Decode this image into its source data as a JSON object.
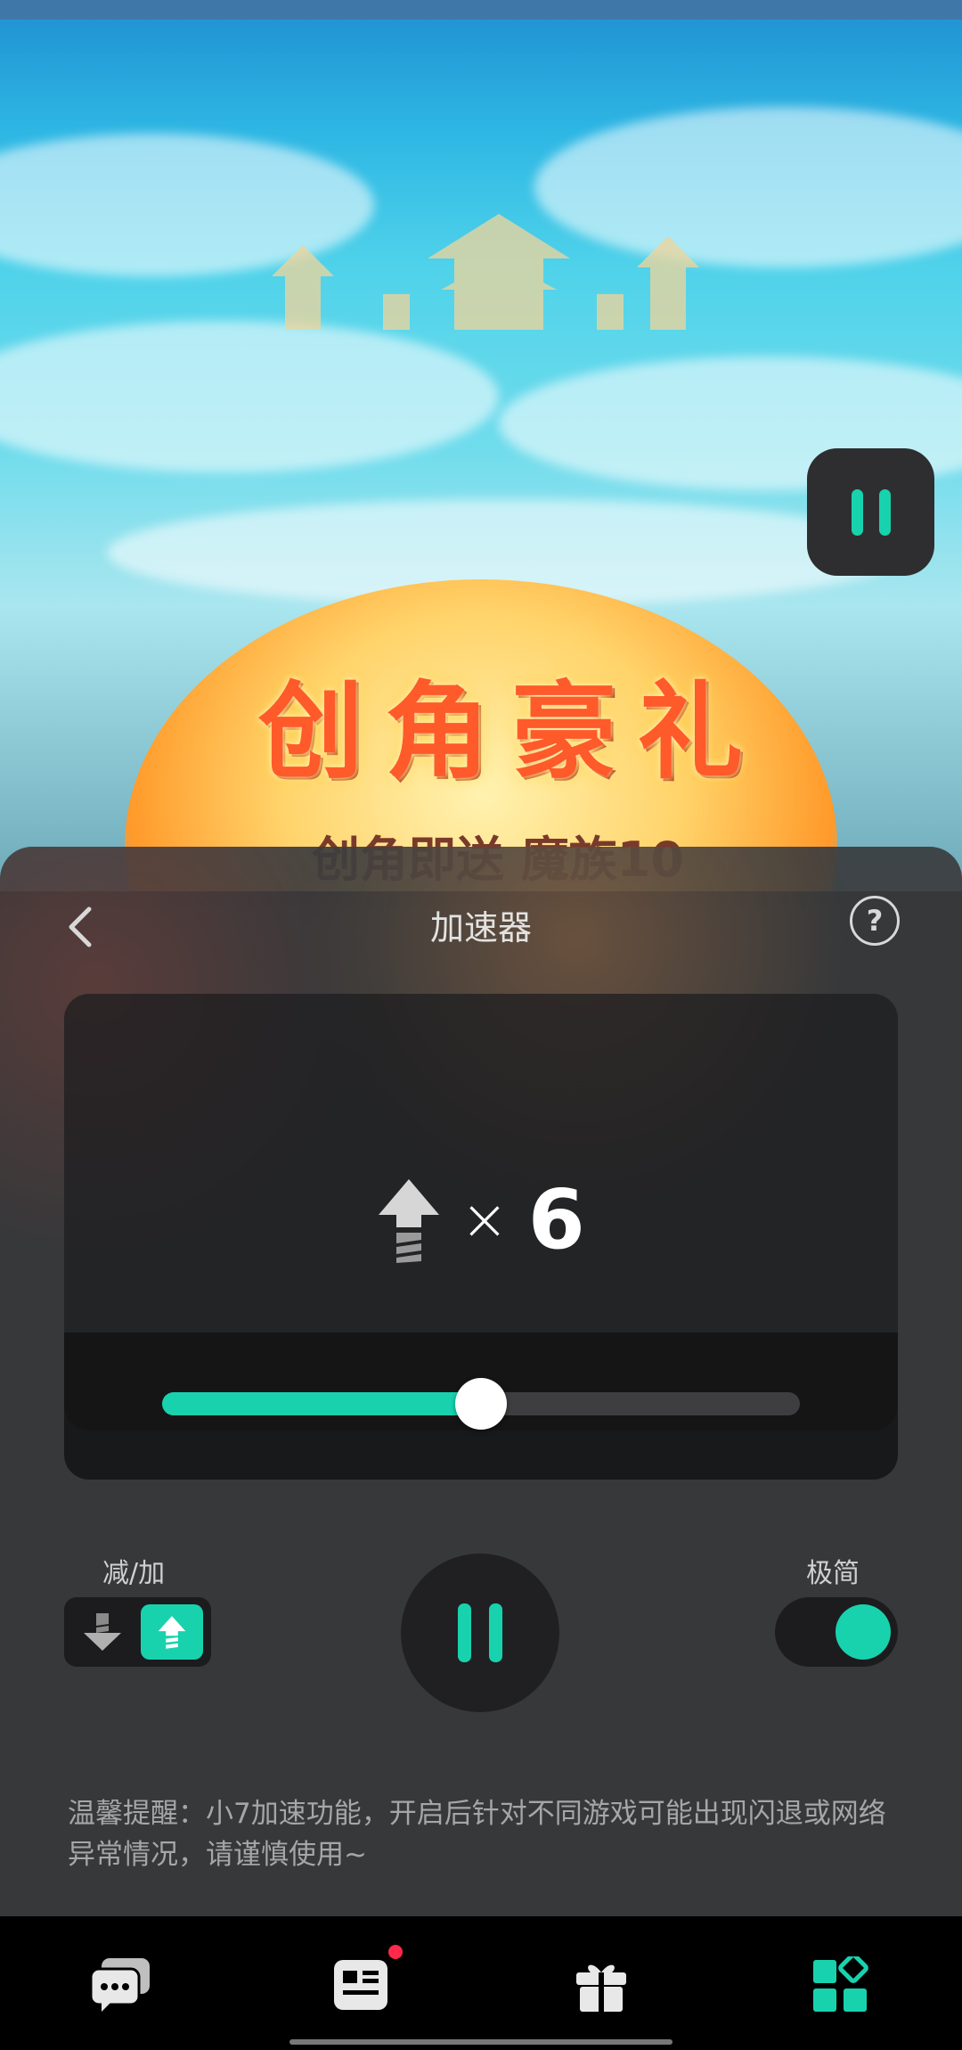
{
  "game_banner": {
    "title": "创角豪礼",
    "subtitle": "创角即送 魔族10"
  },
  "panel": {
    "title": "加速器",
    "speed_times_symbol": "×",
    "speed_multiplier": "6",
    "slider_level": 0.5,
    "mode_label": "减/加",
    "mode_selected": "up",
    "minimal_label": "极简",
    "minimal_on": true,
    "tip": "温馨提醒：小7加速功能，开启后针对不同游戏可能出现闪退或网络异常情况，请谨慎使用~"
  },
  "colors": {
    "accent": "#18d2ae",
    "panel_bg": "#3a3c3e",
    "notification_dot": "#ff2a4a"
  },
  "icons": {
    "back": "chevron-left-icon",
    "help": "question-circle-icon",
    "speed": "speed-up-arrow-icon",
    "pause": "pause-icon",
    "nav": [
      "chat-icon",
      "news-icon",
      "gift-icon",
      "apps-icon"
    ]
  },
  "bottom_nav": {
    "news_has_badge": true,
    "active": "apps"
  }
}
